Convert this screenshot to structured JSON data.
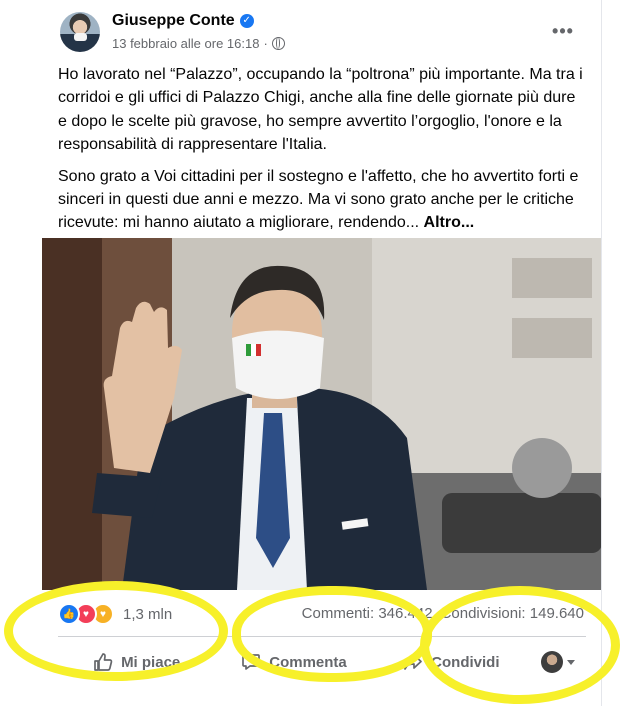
{
  "post": {
    "author": "Giuseppe Conte",
    "timestamp": "13 febbraio alle ore 16:18",
    "separator": "·",
    "paragraph1": "Ho lavorato nel “Palazzo”, occupando la “poltrona” più importante. Ma tra i corridoi e gli uffici di Palazzo Chigi, anche alla fine delle giornate più dure e dopo le scelte più gravose, ho sempre avvertito l’orgoglio, l'onore e la responsabilità di rappresentare l'Italia.",
    "paragraph2": "Sono grato a Voi cittadini per il sostegno e l'affetto, che ho avvertito forti e sinceri in questi due anni e mezzo. Ma vi sono grato anche per le critiche ricevute: mi hanno aiutato a migliorare, rendendo... ",
    "see_more": "Altro..."
  },
  "stats": {
    "reactions_count": "1,3 mln",
    "comments": "Commenti: 346.442",
    "shares": "Condivisioni: 149.640"
  },
  "actions": {
    "like": "Mi piace",
    "comment": "Commenta",
    "share": "Condividi"
  },
  "icons": {
    "verified": "verified-badge-icon",
    "privacy": "globe-icon",
    "more": "more-options-icon",
    "like": "thumbs-up-icon",
    "comment": "comment-bubble-icon",
    "share": "share-arrow-icon"
  },
  "colors": {
    "brand_blue": "#1877f2",
    "secondary_text": "#65676b",
    "annotation_yellow": "#f7f02a"
  }
}
